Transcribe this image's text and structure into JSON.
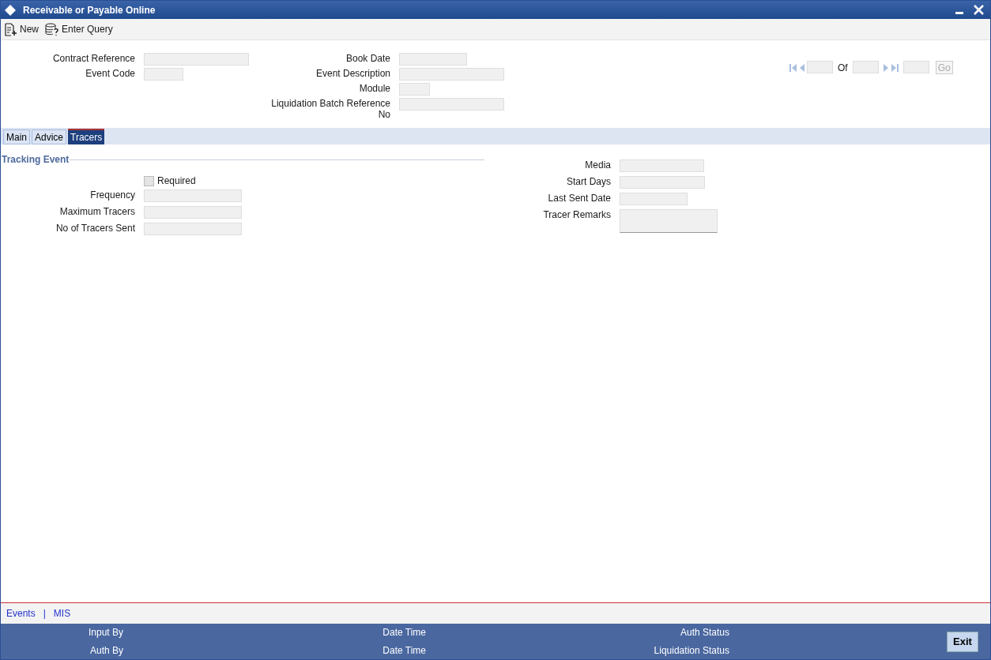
{
  "window": {
    "title": "Receivable or Payable Online"
  },
  "toolbar": [
    {
      "kind": "new",
      "label": "New"
    },
    {
      "kind": "query",
      "label": "Enter Query"
    }
  ],
  "header_left": [
    {
      "label": "Contract Reference"
    },
    {
      "label": "Event Code"
    }
  ],
  "header_middle": [
    {
      "label": "Book Date"
    },
    {
      "label": "Event Description"
    },
    {
      "label": "Module"
    },
    {
      "label": "Liquidation Batch Reference No"
    }
  ],
  "pager": {
    "of_label": "Of",
    "go_label": "Go"
  },
  "tabs": [
    {
      "label": "Main",
      "selected": false
    },
    {
      "label": "Advice",
      "selected": false
    },
    {
      "label": "Tracers",
      "selected": true
    }
  ],
  "tracking_event": {
    "title": "Tracking Event",
    "required": {
      "label": "Required",
      "checked": false
    },
    "left_fields": [
      {
        "label": "Frequency"
      },
      {
        "label": "Maximum Tracers"
      },
      {
        "label": "No of Tracers Sent"
      }
    ],
    "right_fields": [
      {
        "label": "Media"
      },
      {
        "label": "Start Days"
      },
      {
        "label": "Last Sent Date"
      },
      {
        "label": "Tracer Remarks"
      }
    ]
  },
  "footer_links": {
    "items": [
      "Events",
      "MIS"
    ],
    "separator": "|"
  },
  "audit": [
    [
      "Input By",
      "Date Time",
      "Auth Status"
    ],
    [
      "Auth By",
      "Date Time",
      "Liquidation Status"
    ]
  ],
  "exit_button": "Exit"
}
